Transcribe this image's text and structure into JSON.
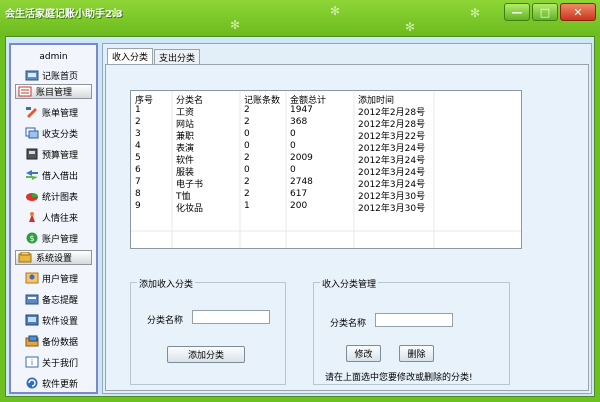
{
  "window": {
    "title": "会生活家庭记账小助手2.3",
    "minimize_glyph": "—",
    "maximize_glyph": "□",
    "close_glyph": "✕"
  },
  "sidebar": {
    "user": "admin",
    "sections": [
      {
        "label": "账目管理",
        "icon": "ledger-icon"
      },
      {
        "label": "系统设置",
        "icon": "settings-icon"
      }
    ],
    "items": [
      {
        "label": "记账首页",
        "icon": "home-icon"
      },
      {
        "label": "账单管理",
        "icon": "bill-icon"
      },
      {
        "label": "收支分类",
        "icon": "category-icon"
      },
      {
        "label": "预算管理",
        "icon": "budget-icon"
      },
      {
        "label": "借入借出",
        "icon": "transfer-icon"
      },
      {
        "label": "统计图表",
        "icon": "chart-icon"
      },
      {
        "label": "人情往来",
        "icon": "gift-icon"
      },
      {
        "label": "账户管理",
        "icon": "account-icon"
      },
      {
        "label": "用户管理",
        "icon": "user-icon"
      },
      {
        "label": "备忘提醒",
        "icon": "memo-icon"
      },
      {
        "label": "软件设置",
        "icon": "software-settings-icon"
      },
      {
        "label": "备份数据",
        "icon": "backup-icon"
      },
      {
        "label": "关于我们",
        "icon": "about-icon"
      },
      {
        "label": "软件更新",
        "icon": "update-icon"
      }
    ]
  },
  "tabs": [
    {
      "label": "收入分类",
      "active": true
    },
    {
      "label": "支出分类",
      "active": false
    }
  ],
  "table": {
    "columns": [
      "序号",
      "分类名",
      "记账条数",
      "金额总计",
      "添加时间"
    ],
    "rows": [
      [
        "1",
        "工资",
        "2",
        "1947",
        "2012年2月28号"
      ],
      [
        "2",
        "网站",
        "2",
        "368",
        "2012年2月28号"
      ],
      [
        "3",
        "兼职",
        "0",
        "0",
        "2012年3月22号"
      ],
      [
        "4",
        "表演",
        "0",
        "0",
        "2012年3月24号"
      ],
      [
        "5",
        "软件",
        "2",
        "2009",
        "2012年3月24号"
      ],
      [
        "6",
        "服装",
        "0",
        "0",
        "2012年3月24号"
      ],
      [
        "7",
        "电子书",
        "2",
        "2748",
        "2012年3月24号"
      ],
      [
        "8",
        "T恤",
        "2",
        "617",
        "2012年3月30号"
      ],
      [
        "9",
        "化妆品",
        "1",
        "200",
        "2012年3月30号"
      ]
    ]
  },
  "add_group": {
    "title": "添加收入分类",
    "name_label": "分类名称",
    "name_value": "",
    "add_button": "添加分类"
  },
  "manage_group": {
    "title": "收入分类管理",
    "name_label": "分类名称",
    "name_value": "",
    "edit_button": "修改",
    "delete_button": "删除",
    "hint": "请在上面选中您要修改或删除的分类!"
  }
}
